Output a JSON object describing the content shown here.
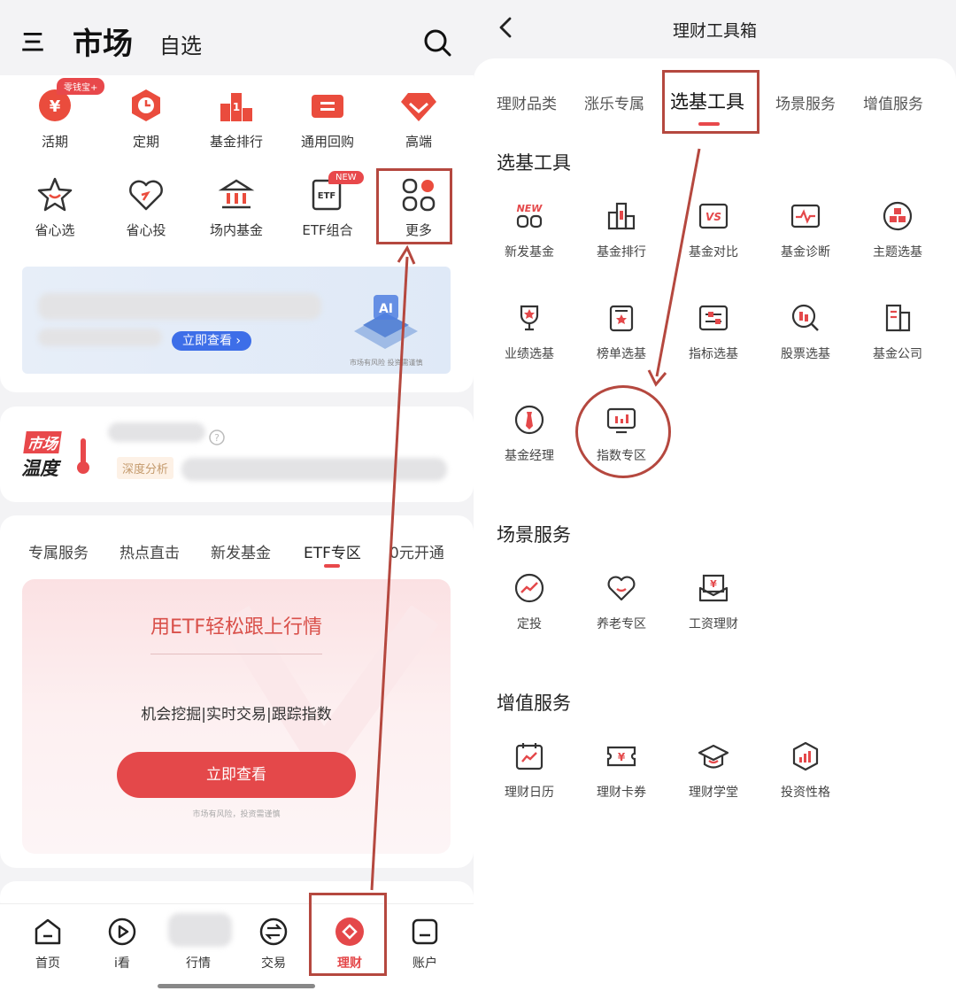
{
  "left": {
    "header": {
      "menu_icon": "三",
      "title": "市场",
      "tab": "自选"
    },
    "icons_row1": [
      {
        "label": "活期",
        "icon": "yen-coin-icon",
        "badge": "零钱宝+"
      },
      {
        "label": "定期",
        "icon": "clock-icon"
      },
      {
        "label": "基金排行",
        "icon": "ranking-icon"
      },
      {
        "label": "通用回购",
        "icon": "ticket-icon"
      },
      {
        "label": "高端",
        "icon": "diamond-icon"
      }
    ],
    "icons_row2": [
      {
        "label": "省心选",
        "icon": "star-icon"
      },
      {
        "label": "省心投",
        "icon": "heart-icon"
      },
      {
        "label": "场内基金",
        "icon": "building-icon"
      },
      {
        "label": "ETF组合",
        "icon": "etf-icon",
        "badge": "NEW"
      },
      {
        "label": "更多",
        "icon": "grid-more-icon"
      }
    ],
    "banner": {
      "button": "立即查看 ›",
      "disclaimer": "市场有风险 投资需谨慎"
    },
    "temperature": {
      "logo_line1": "市场",
      "logo_line2": "温度",
      "tag": "深度分析"
    },
    "tabs": [
      "专属服务",
      "热点直击",
      "新发基金",
      "ETF专区",
      "0元开通"
    ],
    "active_tab": "ETF专区",
    "promo": {
      "title": "用ETF轻松跟上行情",
      "features": "机会挖掘|实时交易|跟踪指数",
      "button": "立即查看",
      "disclaimer": "市场有风险，投资需谨慎"
    },
    "nav": [
      {
        "label": "首页",
        "icon": "home-icon"
      },
      {
        "label": "i看",
        "icon": "play-icon"
      },
      {
        "label": "行情",
        "icon": "chart-icon"
      },
      {
        "label": "交易",
        "icon": "exchange-icon"
      },
      {
        "label": "理财",
        "icon": "wealth-icon"
      },
      {
        "label": "账户",
        "icon": "account-icon"
      }
    ]
  },
  "right": {
    "title": "理财工具箱",
    "back_icon": "back-icon",
    "tabs": [
      "理财品类",
      "涨乐专属",
      "选基工具",
      "场景服务",
      "增值服务"
    ],
    "active_tab": "选基工具",
    "section1": {
      "title": "选基工具",
      "items": [
        {
          "label": "新发基金",
          "icon": "new-fund-icon",
          "badge": "NEW"
        },
        {
          "label": "基金排行",
          "icon": "ranking-icon"
        },
        {
          "label": "基金对比",
          "icon": "vs-icon",
          "badge": "VS"
        },
        {
          "label": "基金诊断",
          "icon": "pulse-icon"
        },
        {
          "label": "主题选基",
          "icon": "theme-icon"
        },
        {
          "label": "业绩选基",
          "icon": "trophy-icon"
        },
        {
          "label": "榜单选基",
          "icon": "list-icon"
        },
        {
          "label": "指标选基",
          "icon": "slider-icon"
        },
        {
          "label": "股票选基",
          "icon": "stock-search-icon"
        },
        {
          "label": "基金公司",
          "icon": "company-icon"
        },
        {
          "label": "基金经理",
          "icon": "manager-icon"
        },
        {
          "label": "指数专区",
          "icon": "index-monitor-icon"
        }
      ]
    },
    "section2": {
      "title": "场景服务",
      "items": [
        {
          "label": "定投",
          "icon": "trend-icon"
        },
        {
          "label": "养老专区",
          "icon": "heart-icon"
        },
        {
          "label": "工资理财",
          "icon": "salary-icon"
        }
      ]
    },
    "section3": {
      "title": "增值服务",
      "items": [
        {
          "label": "理财日历",
          "icon": "calendar-icon"
        },
        {
          "label": "理财卡券",
          "icon": "coupon-icon"
        },
        {
          "label": "理财学堂",
          "icon": "graduation-icon"
        },
        {
          "label": "投资性格",
          "icon": "personality-icon"
        }
      ]
    }
  },
  "colors": {
    "accent": "#e8484b",
    "annotation": "#b5483f"
  }
}
